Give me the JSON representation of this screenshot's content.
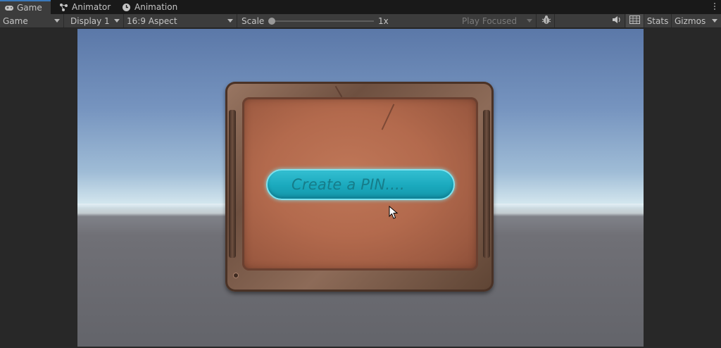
{
  "tabs": [
    {
      "label": "Game",
      "icon": "gamepad-icon",
      "active": true
    },
    {
      "label": "Animator",
      "icon": "animator-icon",
      "active": false
    },
    {
      "label": "Animation",
      "icon": "clock-icon",
      "active": false
    }
  ],
  "toolbar": {
    "view_mode": "Game",
    "display": "Display 1",
    "aspect": "16:9 Aspect",
    "scale_label": "Scale",
    "scale_value": "1x",
    "play_mode": "Play Focused",
    "stats_label": "Stats",
    "gizmos_label": "Gizmos"
  },
  "game": {
    "pin_placeholder": "Create a PIN...."
  },
  "colors": {
    "accent": "#3a79bb",
    "pin_field": "#1aa9bd",
    "panel": "#b36a4d"
  }
}
